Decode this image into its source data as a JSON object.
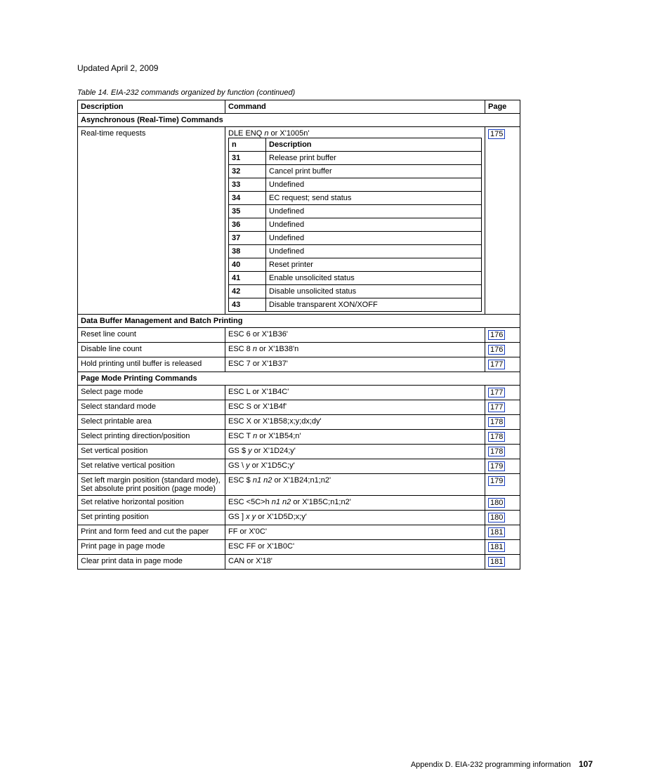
{
  "updated": "Updated April 2, 2009",
  "caption": "Table 14. EIA-232 commands organized by function  (continued)",
  "headers": {
    "desc": "Description",
    "cmd": "Command",
    "page": "Page"
  },
  "sections": {
    "async": "Asynchronous (Real-Time) Commands",
    "buffer": "Data Buffer Management and Batch Printing",
    "pagemode": "Page Mode Printing Commands"
  },
  "realtime": {
    "desc": "Real-time requests",
    "cmd_prefix": "DLE ENQ ",
    "cmd_var": "n",
    "cmd_suffix": " or X'1005n'",
    "page": "175",
    "inner_headers": {
      "n": "n",
      "d": "Description"
    },
    "items": [
      {
        "n": "31",
        "d": "Release print buffer"
      },
      {
        "n": "32",
        "d": "Cancel print buffer"
      },
      {
        "n": "33",
        "d": "Undefined"
      },
      {
        "n": "34",
        "d": "EC request; send status"
      },
      {
        "n": "35",
        "d": "Undefined"
      },
      {
        "n": "36",
        "d": "Undefined"
      },
      {
        "n": "37",
        "d": "Undefined"
      },
      {
        "n": "38",
        "d": "Undefined"
      },
      {
        "n": "40",
        "d": "Reset printer"
      },
      {
        "n": "41",
        "d": "Enable unsolicited status"
      },
      {
        "n": "42",
        "d": "Disable unsolicited status"
      },
      {
        "n": "43",
        "d": "Disable transparent XON/XOFF"
      }
    ]
  },
  "buffer_rows": [
    {
      "desc": "Reset line count",
      "cmd": "ESC 6 or X'1B36'",
      "page": "176"
    },
    {
      "desc": "Disable line count",
      "cmd_pre": "ESC 8 ",
      "cmd_i": "n",
      "cmd_suf": " or X'1B38'n",
      "page": "176"
    },
    {
      "desc": "Hold printing until buffer is released",
      "cmd": "ESC 7 or X'1B37'",
      "page": "177"
    }
  ],
  "pagemode_rows": [
    {
      "desc": "Select page mode",
      "cmd": "ESC L or X'1B4C'",
      "page": "177"
    },
    {
      "desc": "Select standard mode",
      "cmd": "ESC S or X'1B4f'",
      "page": "177"
    },
    {
      "desc": "Select printable area",
      "cmd": "ESC X or X'1B58;x;y;dx;dy'",
      "page": "178"
    },
    {
      "desc": "Select printing direction/position",
      "cmd_pre": "ESC T ",
      "cmd_i": "n",
      "cmd_suf": " or X'1B54;n'",
      "page": "178"
    },
    {
      "desc": "Set vertical position",
      "cmd_pre": "GS $ ",
      "cmd_i": "y",
      "cmd_suf": " or X'1D24;y'",
      "page": "178"
    },
    {
      "desc": "Set relative vertical position",
      "cmd_pre": "GS \\ ",
      "cmd_i": "y",
      "cmd_suf": " or X'1D5C;y'",
      "page": "179"
    },
    {
      "desc": "Set left margin position (standard mode), Set absolute print position (page mode)",
      "cmd_pre": "ESC $ ",
      "cmd_i": "n1 n2",
      "cmd_suf": " or X'1B24;n1;n2'",
      "page": "179"
    },
    {
      "desc": "Set relative horizontal position",
      "cmd_pre": "ESC <5C>h ",
      "cmd_i": "n1 n2",
      "cmd_suf": " or X'1B5C;n1;n2'",
      "page": "180"
    },
    {
      "desc": "Set printing position",
      "cmd_pre": "GS ] ",
      "cmd_i": "x y",
      "cmd_suf": " or X'1D5D;x;y'",
      "page": "180"
    },
    {
      "desc": "Print and form feed and cut the paper",
      "cmd": "FF or X'0C'",
      "page": "181"
    },
    {
      "desc": "Print page in page mode",
      "cmd": "ESC FF or X'1B0C'",
      "page": "181"
    },
    {
      "desc": "Clear print data in page mode",
      "cmd": "CAN or X'18'",
      "page": "181"
    }
  ],
  "footer": {
    "text": "Appendix D. EIA-232 programming information",
    "page": "107"
  }
}
